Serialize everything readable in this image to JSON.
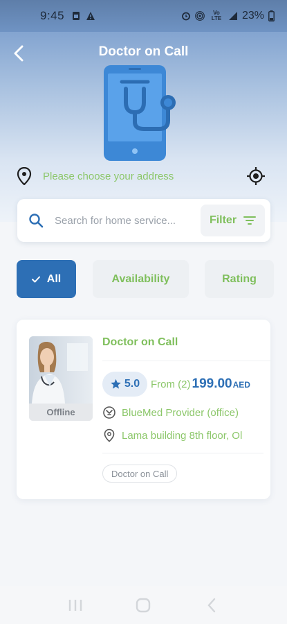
{
  "status_bar": {
    "time": "9:45",
    "battery": "23%",
    "network_label": "Vo LTE"
  },
  "header": {
    "title": "Doctor on Call",
    "back_icon": "chevron-left-icon",
    "illustration": "phone-stethoscope-illustration"
  },
  "address": {
    "text": "Please choose your address",
    "pin_icon": "map-pin-icon",
    "locate_icon": "crosshair-locate-icon"
  },
  "search": {
    "placeholder": "Search for home service...",
    "filter_label": "Filter"
  },
  "filters": {
    "chips": [
      {
        "label": "All",
        "selected": true
      },
      {
        "label": "Availability",
        "selected": false
      },
      {
        "label": "Rating",
        "selected": false
      }
    ]
  },
  "results": [
    {
      "title": "Doctor on Call",
      "status": "Offline",
      "rating": "5.0",
      "price_prefix": "From (2)",
      "price": "199.00",
      "currency": "AED",
      "provider": "BlueMed Provider (office)",
      "location": "Lama building 8th floor, Ol",
      "tag": "Doctor on Call"
    }
  ],
  "colors": {
    "primary": "#2d6fb5",
    "accent_green": "#7fbf5c",
    "background": "#f4f6f9"
  }
}
